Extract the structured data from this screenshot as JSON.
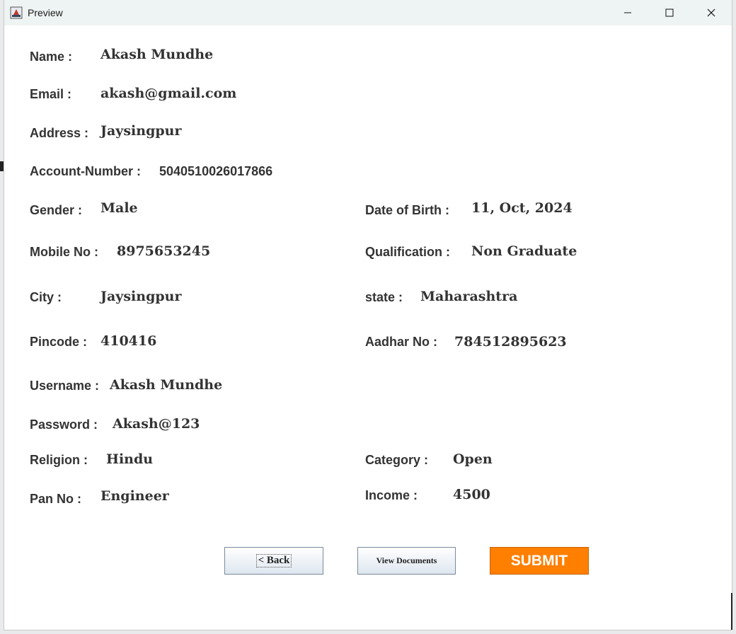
{
  "window": {
    "title": "Preview"
  },
  "fields": {
    "name": {
      "label": "Name :",
      "value": "Akash Mundhe"
    },
    "email": {
      "label": "Email :",
      "value": "akash@gmail.com"
    },
    "address": {
      "label": "Address :",
      "value": "Jaysingpur"
    },
    "account_number": {
      "label": "Account-Number :",
      "value": "5040510026017866"
    },
    "gender": {
      "label": "Gender :",
      "value": "Male"
    },
    "date_of_birth": {
      "label": "Date of Birth :",
      "value": "11, Oct, 2024"
    },
    "mobile_no": {
      "label": "Mobile No :",
      "value": "8975653245"
    },
    "qualification": {
      "label": "Qualification :",
      "value": "Non Graduate"
    },
    "city": {
      "label": "City :",
      "value": "Jaysingpur"
    },
    "state": {
      "label": "state :",
      "value": "Maharashtra"
    },
    "pincode": {
      "label": "Pincode :",
      "value": "410416"
    },
    "aadhar_no": {
      "label": "Aadhar No :",
      "value": "784512895623"
    },
    "username": {
      "label": "Username :",
      "value": "Akash Mundhe"
    },
    "password": {
      "label": "Password :",
      "value": "Akash@123"
    },
    "religion": {
      "label": "Religion :",
      "value": "Hindu"
    },
    "category": {
      "label": "Category :",
      "value": "Open"
    },
    "pan_no": {
      "label": "Pan No :",
      "value": "Engineer"
    },
    "income": {
      "label": "Income :",
      "value": "4500"
    }
  },
  "buttons": {
    "back": "< Back",
    "view_documents": "View Documents",
    "submit": "SUBMIT"
  },
  "colors": {
    "submit_bg": "#ff7f00",
    "title_bar": "#eef4f3"
  }
}
